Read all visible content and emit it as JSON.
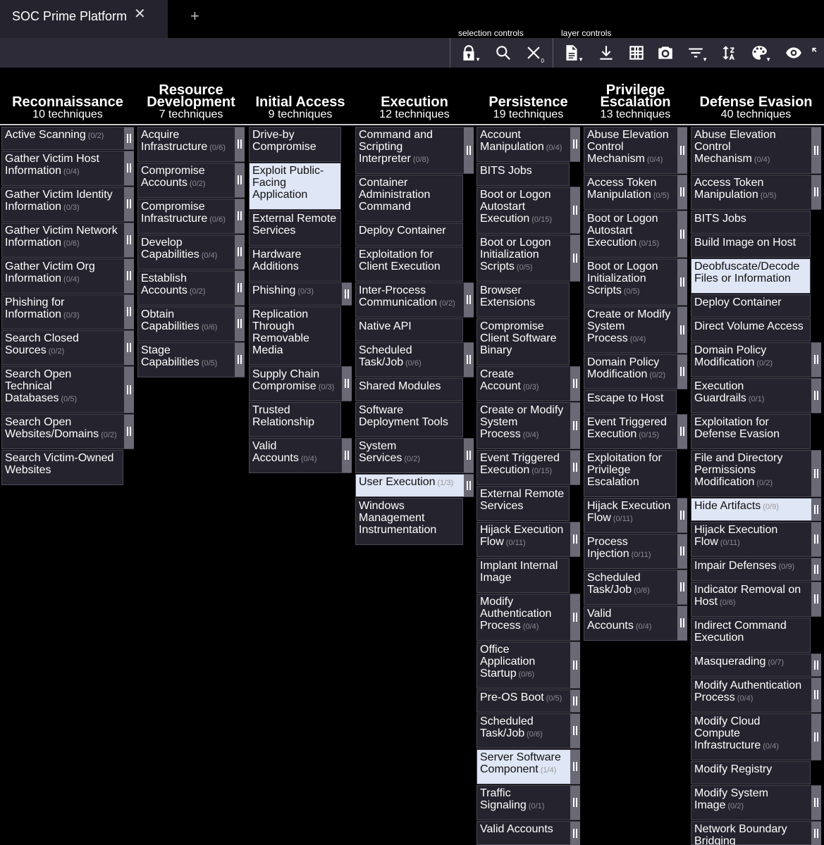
{
  "tab": {
    "title": "SOC Prime Platform",
    "close": "✕",
    "add": "+"
  },
  "toolbar": {
    "selection_label": "selection controls",
    "layer_label": "layer controls",
    "icons": [
      "lock-icon",
      "search-icon",
      "clear-selection-icon",
      "export-file-icon",
      "download-icon",
      "grid-icon",
      "camera-icon",
      "filter-icon",
      "sort-icon",
      "palette-icon",
      "eye-icon",
      "expand-icon"
    ]
  },
  "tactics": [
    {
      "name": "Reconnaissance",
      "count": "10 techniques",
      "techniques": [
        {
          "name": "Active Scanning",
          "sub": "(0/2)"
        },
        {
          "name": "Gather Victim Host Information",
          "sub": "(0/4)"
        },
        {
          "name": "Gather Victim Identity Information",
          "sub": "(0/3)"
        },
        {
          "name": "Gather Victim Network Information",
          "sub": "(0/6)"
        },
        {
          "name": "Gather Victim Org Information",
          "sub": "(0/4)"
        },
        {
          "name": "Phishing for Information",
          "sub": "(0/3)"
        },
        {
          "name": "Search Closed Sources",
          "sub": "(0/2)"
        },
        {
          "name": "Search Open Technical Databases",
          "sub": "(0/5)"
        },
        {
          "name": "Search Open Websites/Domains",
          "sub": "(0/2)"
        },
        {
          "name": "Search Victim-Owned Websites",
          "sub": ""
        }
      ]
    },
    {
      "name": "Resource Development",
      "count": "7 techniques",
      "techniques": [
        {
          "name": "Acquire Infrastructure",
          "sub": "(0/6)"
        },
        {
          "name": "Compromise Accounts",
          "sub": "(0/2)"
        },
        {
          "name": "Compromise Infrastructure",
          "sub": "(0/6)"
        },
        {
          "name": "Develop Capabilities",
          "sub": "(0/4)"
        },
        {
          "name": "Establish Accounts",
          "sub": "(0/2)"
        },
        {
          "name": "Obtain Capabilities",
          "sub": "(0/6)"
        },
        {
          "name": "Stage Capabilities",
          "sub": "(0/5)"
        }
      ]
    },
    {
      "name": "Initial Access",
      "count": "9 techniques",
      "techniques": [
        {
          "name": "Drive-by Compromise",
          "sub": ""
        },
        {
          "name": "Exploit Public-Facing Application",
          "sub": "",
          "hl": true
        },
        {
          "name": "External Remote Services",
          "sub": ""
        },
        {
          "name": "Hardware Additions",
          "sub": ""
        },
        {
          "name": "Phishing",
          "sub": "(0/3)"
        },
        {
          "name": "Replication Through Removable Media",
          "sub": ""
        },
        {
          "name": "Supply Chain Compromise",
          "sub": "(0/3)"
        },
        {
          "name": "Trusted Relationship",
          "sub": ""
        },
        {
          "name": "Valid Accounts",
          "sub": "(0/4)"
        }
      ]
    },
    {
      "name": "Execution",
      "count": "12 techniques",
      "techniques": [
        {
          "name": "Command and Scripting Interpreter",
          "sub": "(0/8)"
        },
        {
          "name": "Container Administration Command",
          "sub": ""
        },
        {
          "name": "Deploy Container",
          "sub": ""
        },
        {
          "name": "Exploitation for Client Execution",
          "sub": ""
        },
        {
          "name": "Inter-Process Communication",
          "sub": "(0/2)"
        },
        {
          "name": "Native API",
          "sub": ""
        },
        {
          "name": "Scheduled Task/Job",
          "sub": "(0/6)"
        },
        {
          "name": "Shared Modules",
          "sub": ""
        },
        {
          "name": "Software Deployment Tools",
          "sub": ""
        },
        {
          "name": "System Services",
          "sub": "(0/2)"
        },
        {
          "name": "User Execution",
          "sub": "(1/3)",
          "hl": true
        },
        {
          "name": "Windows Management Instrumentation",
          "sub": ""
        }
      ]
    },
    {
      "name": "Persistence",
      "count": "19 techniques",
      "techniques": [
        {
          "name": "Account Manipulation",
          "sub": "(0/4)"
        },
        {
          "name": "BITS Jobs",
          "sub": ""
        },
        {
          "name": "Boot or Logon Autostart Execution",
          "sub": "(0/15)"
        },
        {
          "name": "Boot or Logon Initialization Scripts",
          "sub": "(0/5)"
        },
        {
          "name": "Browser Extensions",
          "sub": ""
        },
        {
          "name": "Compromise Client Software Binary",
          "sub": ""
        },
        {
          "name": "Create Account",
          "sub": "(0/3)"
        },
        {
          "name": "Create or Modify System Process",
          "sub": "(0/4)"
        },
        {
          "name": "Event Triggered Execution",
          "sub": "(0/15)"
        },
        {
          "name": "External Remote Services",
          "sub": ""
        },
        {
          "name": "Hijack Execution Flow",
          "sub": "(0/11)"
        },
        {
          "name": "Implant Internal Image",
          "sub": ""
        },
        {
          "name": "Modify Authentication Process",
          "sub": "(0/4)"
        },
        {
          "name": "Office Application Startup",
          "sub": "(0/6)"
        },
        {
          "name": "Pre-OS Boot",
          "sub": "(0/5)"
        },
        {
          "name": "Scheduled Task/Job",
          "sub": "(0/6)"
        },
        {
          "name": "Server Software Component",
          "sub": "(1/4)",
          "hl": true
        },
        {
          "name": "Traffic Signaling",
          "sub": "(0/1)"
        },
        {
          "name": "Valid Accounts",
          "sub": ""
        }
      ]
    },
    {
      "name": "Privilege Escalation",
      "count": "13 techniques",
      "techniques": [
        {
          "name": "Abuse Elevation Control Mechanism",
          "sub": "(0/4)"
        },
        {
          "name": "Access Token Manipulation",
          "sub": "(0/5)"
        },
        {
          "name": "Boot or Logon Autostart Execution",
          "sub": "(0/15)"
        },
        {
          "name": "Boot or Logon Initialization Scripts",
          "sub": "(0/5)"
        },
        {
          "name": "Create or Modify System Process",
          "sub": "(0/4)"
        },
        {
          "name": "Domain Policy Modification",
          "sub": "(0/2)"
        },
        {
          "name": "Escape to Host",
          "sub": ""
        },
        {
          "name": "Event Triggered Execution",
          "sub": "(0/15)"
        },
        {
          "name": "Exploitation for Privilege Escalation",
          "sub": ""
        },
        {
          "name": "Hijack Execution Flow",
          "sub": "(0/11)"
        },
        {
          "name": "Process Injection",
          "sub": "(0/11)"
        },
        {
          "name": "Scheduled Task/Job",
          "sub": "(0/6)"
        },
        {
          "name": "Valid Accounts",
          "sub": "(0/4)"
        }
      ]
    },
    {
      "name": "Defense Evasion",
      "count": "40 techniques",
      "techniques": [
        {
          "name": "Abuse Elevation Control Mechanism",
          "sub": "(0/4)"
        },
        {
          "name": "Access Token Manipulation",
          "sub": "(0/5)"
        },
        {
          "name": "BITS Jobs",
          "sub": ""
        },
        {
          "name": "Build Image on Host",
          "sub": ""
        },
        {
          "name": "Deobfuscate/Decode Files or Information",
          "sub": "",
          "hl": true
        },
        {
          "name": "Deploy Container",
          "sub": ""
        },
        {
          "name": "Direct Volume Access",
          "sub": ""
        },
        {
          "name": "Domain Policy Modification",
          "sub": "(0/2)"
        },
        {
          "name": "Execution Guardrails",
          "sub": "(0/1)"
        },
        {
          "name": "Exploitation for Defense Evasion",
          "sub": ""
        },
        {
          "name": "File and Directory Permissions Modification",
          "sub": "(0/2)"
        },
        {
          "name": "Hide Artifacts",
          "sub": "(0/9)",
          "hl": true
        },
        {
          "name": "Hijack Execution Flow",
          "sub": "(0/11)"
        },
        {
          "name": "Impair Defenses",
          "sub": "(0/9)"
        },
        {
          "name": "Indicator Removal on Host",
          "sub": "(0/6)"
        },
        {
          "name": "Indirect Command Execution",
          "sub": ""
        },
        {
          "name": "Masquerading",
          "sub": "(0/7)"
        },
        {
          "name": "Modify Authentication Process",
          "sub": "(0/4)"
        },
        {
          "name": "Modify Cloud Compute Infrastructure",
          "sub": "(0/4)"
        },
        {
          "name": "Modify Registry",
          "sub": ""
        },
        {
          "name": "Modify System Image",
          "sub": "(0/2)"
        },
        {
          "name": "Network Boundary Bridging",
          "sub": ""
        }
      ]
    }
  ]
}
